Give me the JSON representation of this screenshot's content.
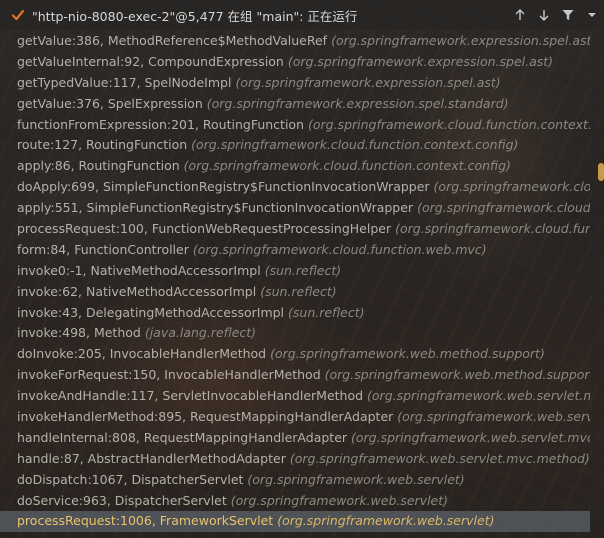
{
  "header": {
    "title": "\"http-nio-8080-exec-2\"@5,477 在组 \"main\": 正在运行",
    "tools": [
      {
        "name": "up-arrow-icon"
      },
      {
        "name": "down-arrow-icon"
      },
      {
        "name": "filter-icon"
      },
      {
        "name": "dropdown-icon"
      }
    ]
  },
  "frames": [
    {
      "method": "getValue:386, MethodReference$MethodValueRef",
      "pkg": "(org.springframework.expression.spel.ast)"
    },
    {
      "method": "getValueInternal:92, CompoundExpression",
      "pkg": "(org.springframework.expression.spel.ast)"
    },
    {
      "method": "getTypedValue:117, SpelNodeImpl",
      "pkg": "(org.springframework.expression.spel.ast)"
    },
    {
      "method": "getValue:376, SpelExpression",
      "pkg": "(org.springframework.expression.spel.standard)"
    },
    {
      "method": "functionFromExpression:201, RoutingFunction",
      "pkg": "(org.springframework.cloud.function.context.config)"
    },
    {
      "method": "route:127, RoutingFunction",
      "pkg": "(org.springframework.cloud.function.context.config)"
    },
    {
      "method": "apply:86, RoutingFunction",
      "pkg": "(org.springframework.cloud.function.context.config)"
    },
    {
      "method": "doApply:699, SimpleFunctionRegistry$FunctionInvocationWrapper",
      "pkg": "(org.springframework.cloud.funct"
    },
    {
      "method": "apply:551, SimpleFunctionRegistry$FunctionInvocationWrapper",
      "pkg": "(org.springframework.cloud.function"
    },
    {
      "method": "processRequest:100, FunctionWebRequestProcessingHelper",
      "pkg": "(org.springframework.cloud.function.w"
    },
    {
      "method": "form:84, FunctionController",
      "pkg": "(org.springframework.cloud.function.web.mvc)"
    },
    {
      "method": "invoke0:-1, NativeMethodAccessorImpl",
      "pkg": "(sun.reflect)"
    },
    {
      "method": "invoke:62, NativeMethodAccessorImpl",
      "pkg": "(sun.reflect)"
    },
    {
      "method": "invoke:43, DelegatingMethodAccessorImpl",
      "pkg": "(sun.reflect)"
    },
    {
      "method": "invoke:498, Method",
      "pkg": "(java.lang.reflect)"
    },
    {
      "method": "doInvoke:205, InvocableHandlerMethod",
      "pkg": "(org.springframework.web.method.support)"
    },
    {
      "method": "invokeForRequest:150, InvocableHandlerMethod",
      "pkg": "(org.springframework.web.method.support)"
    },
    {
      "method": "invokeAndHandle:117, ServletInvocableHandlerMethod",
      "pkg": "(org.springframework.web.servlet.mvc.meth"
    },
    {
      "method": "invokeHandlerMethod:895, RequestMappingHandlerAdapter",
      "pkg": "(org.springframework.web.servlet.mvc"
    },
    {
      "method": "handleInternal:808, RequestMappingHandlerAdapter",
      "pkg": "(org.springframework.web.servlet.mvc.metho"
    },
    {
      "method": "handle:87, AbstractHandlerMethodAdapter",
      "pkg": "(org.springframework.web.servlet.mvc.method)"
    },
    {
      "method": "doDispatch:1067, DispatcherServlet",
      "pkg": "(org.springframework.web.servlet)"
    },
    {
      "method": "doService:963, DispatcherServlet",
      "pkg": "(org.springframework.web.servlet)"
    },
    {
      "method": "processRequest:1006, FrameworkServlet",
      "pkg": "(org.springframework.web.servlet)"
    }
  ],
  "selected_index": 23,
  "colors": {
    "check": "#e0702a",
    "selected_text": "#e8c46a",
    "text": "#b4b0aa"
  }
}
